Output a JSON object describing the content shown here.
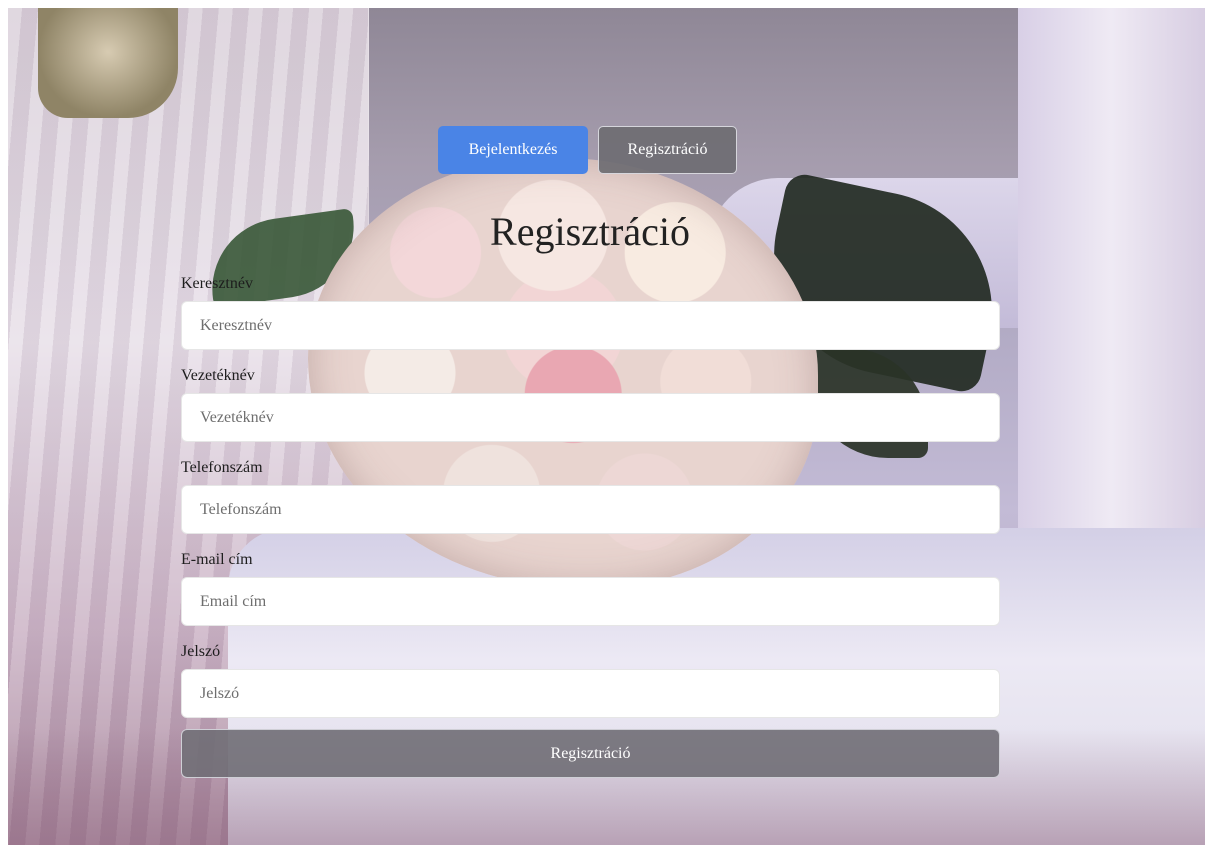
{
  "tabs": {
    "login_label": "Bejelentkezés",
    "register_label": "Regisztráció"
  },
  "form": {
    "title": "Regisztráció",
    "fields": [
      {
        "label": "Keresztnév",
        "placeholder": "Keresztnév",
        "value": ""
      },
      {
        "label": "Vezetéknév",
        "placeholder": "Vezetéknév",
        "value": ""
      },
      {
        "label": "Telefonszám",
        "placeholder": "Telefonszám",
        "value": ""
      },
      {
        "label": "E-mail cím",
        "placeholder": "Email cím",
        "value": ""
      },
      {
        "label": "Jelszó",
        "placeholder": "Jelszó",
        "value": ""
      }
    ],
    "submit_label": "Regisztráció"
  },
  "colors": {
    "login_tab": "#4a84e6",
    "register_tab": "#6e6c72",
    "submit_button": "#706e76",
    "title_text": "#222222"
  }
}
